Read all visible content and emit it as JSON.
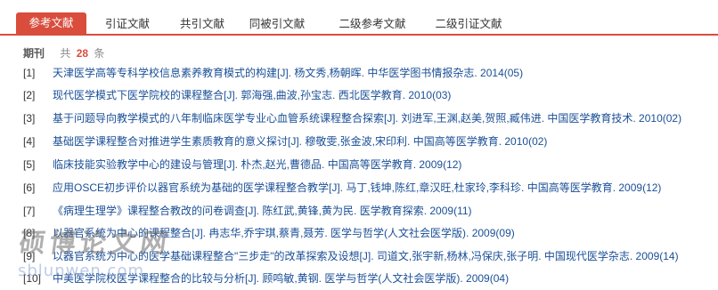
{
  "tabs": [
    {
      "label": "参考文献",
      "active": true
    },
    {
      "label": "引证文献",
      "active": false
    },
    {
      "label": "共引文献",
      "active": false
    },
    {
      "label": "同被引文献",
      "active": false
    },
    {
      "label": "二级参考文献",
      "active": false
    },
    {
      "label": "二级引证文献",
      "active": false
    }
  ],
  "summary": {
    "type": "期刊",
    "prefix": "共",
    "count": "28",
    "unit": "条"
  },
  "references": [
    {
      "num": "[1]",
      "title": "天津医学高等专科学校信息素养教育模式的构建",
      "tail": "[J]. 杨文秀,杨朝晖.",
      "source": "中华医学图书情报杂志. 2014(05)"
    },
    {
      "num": "[2]",
      "title": "现代医学模式下医学院校的课程整合",
      "tail": "[J]. 郭海强,曲波,孙宝志.",
      "source": "西北医学教育. 2010(03)"
    },
    {
      "num": "[3]",
      "title": "基于问题导向教学模式的八年制临床医学专业心血管系统课程整合探索",
      "tail": "[J]. 刘进军,王渊,赵美,贺照,臧伟进.",
      "source": "中国医学教育技术. 2010(02)"
    },
    {
      "num": "[4]",
      "title": "基础医学课程整合对推进学生素质教育的意义探讨",
      "tail": "[J]. 穆敬雯,张金波,宋印利.",
      "source": "中国高等医学教育. 2010(02)"
    },
    {
      "num": "[5]",
      "title": "临床技能实验教学中心的建设与管理",
      "tail": "[J]. 朴杰,赵光,曹德品.",
      "source": "中国高等医学教育. 2009(12)"
    },
    {
      "num": "[6]",
      "title": "应用OSCE初步评价以器官系统为基础的医学课程整合教学",
      "tail": "[J]. 马丁,钱坤,陈红,章汉旺,杜家玲,李科珍.",
      "source": "中国高等医学教育. 2009(12)"
    },
    {
      "num": "[7]",
      "title": "《病理生理学》课程整合教改的问卷调查",
      "tail": "[J]. 陈红武,黄锋,黄为民.",
      "source": "医学教育探索. 2009(11)"
    },
    {
      "num": "[8]",
      "title": "以器官系统为中心的课程整合",
      "tail": "[J]. 冉志华,乔宇琪,蔡青,聂芳.",
      "source": "医学与哲学(人文社会医学版). 2009(09)"
    },
    {
      "num": "[9]",
      "title": "以器官系统为中心的医学基础课程整合\"三步走\"的改革探索及设想",
      "tail": "[J]. 司道文,张宇新,杨林,冯保庆,张子明.",
      "source": "中国现代医学杂志. 2009(14)"
    },
    {
      "num": "[10]",
      "title": "中美医学院校医学课程整合的比较与分析",
      "tail": "[J]. 顾鸣敏,黄钢.",
      "source": "医学与哲学(人文社会医学版). 2009(04)"
    }
  ],
  "watermark": {
    "text": "硕博论文网",
    "sub": "sblunwen.com"
  }
}
